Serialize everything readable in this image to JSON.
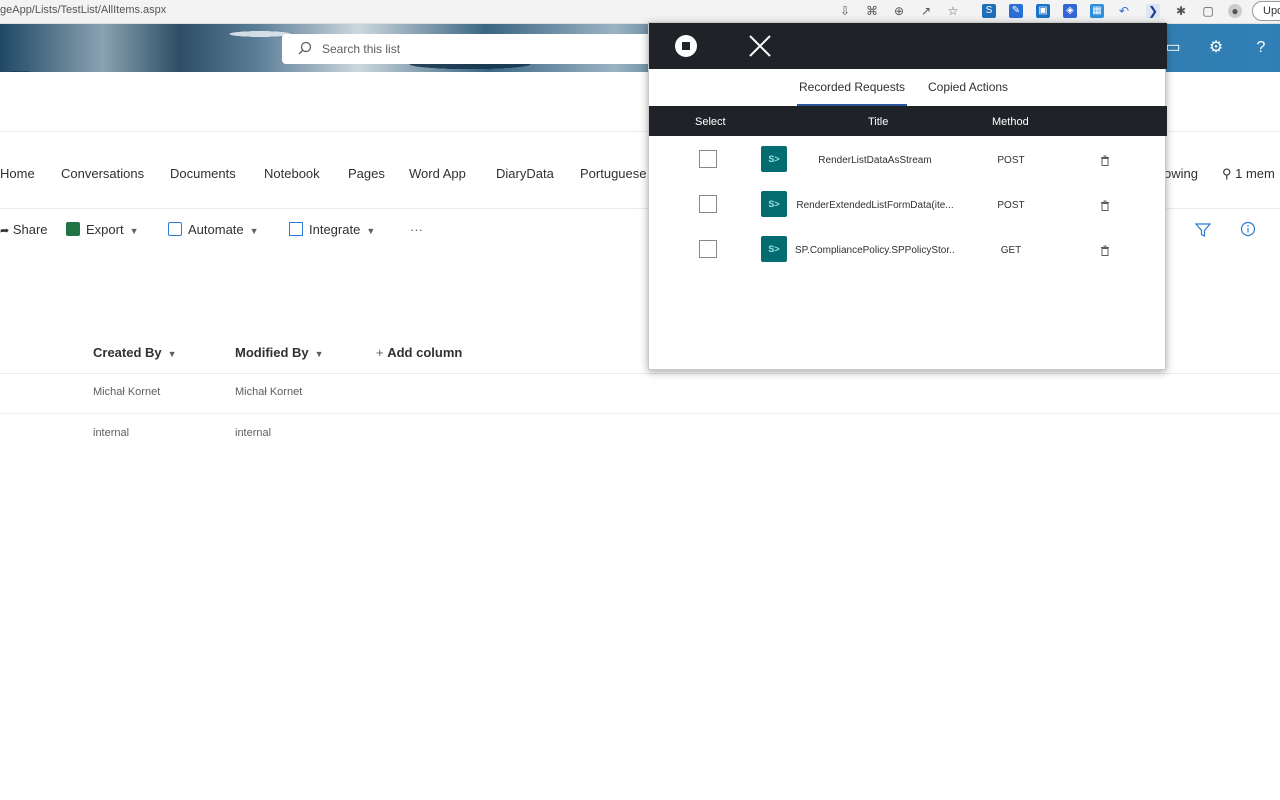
{
  "browser": {
    "url": "geApp/Lists/TestList/AllItems.aspx",
    "update_label": "Upd"
  },
  "header": {
    "search_placeholder": "Search this list"
  },
  "nav": {
    "items": [
      "Home",
      "Conversations",
      "Documents",
      "Notebook",
      "Pages",
      "Word App",
      "DiaryData",
      "Portuguese"
    ],
    "following_label": "owing",
    "members_label": "1 mem"
  },
  "command_bar": {
    "share": "Share",
    "export": "Export",
    "automate": "Automate",
    "integrate": "Integrate",
    "more": "···"
  },
  "list": {
    "columns": [
      "Created By",
      "Modified By",
      "Add column"
    ],
    "rows": [
      {
        "created_by": "Michał Kornet",
        "modified_by": "Michał Kornet"
      },
      {
        "created_by": "internal",
        "modified_by": "internal"
      }
    ]
  },
  "panel": {
    "tabs": [
      "Recorded Requests",
      "Copied Actions"
    ],
    "active_tab": "Recorded Requests",
    "headers": {
      "select": "Select",
      "title": "Title",
      "method": "Method"
    },
    "requests": [
      {
        "title": "RenderListDataAsStream",
        "method": "POST"
      },
      {
        "title": "RenderExtendedListFormData(ite...",
        "method": "POST"
      },
      {
        "title": "SP.CompliancePolicy.SPPolicyStor...",
        "method": "GET"
      }
    ]
  },
  "colors": {
    "panel_dark": "#1f2328",
    "sharepoint_teal": "#036c70",
    "header_blue": "#2f7fb6"
  }
}
